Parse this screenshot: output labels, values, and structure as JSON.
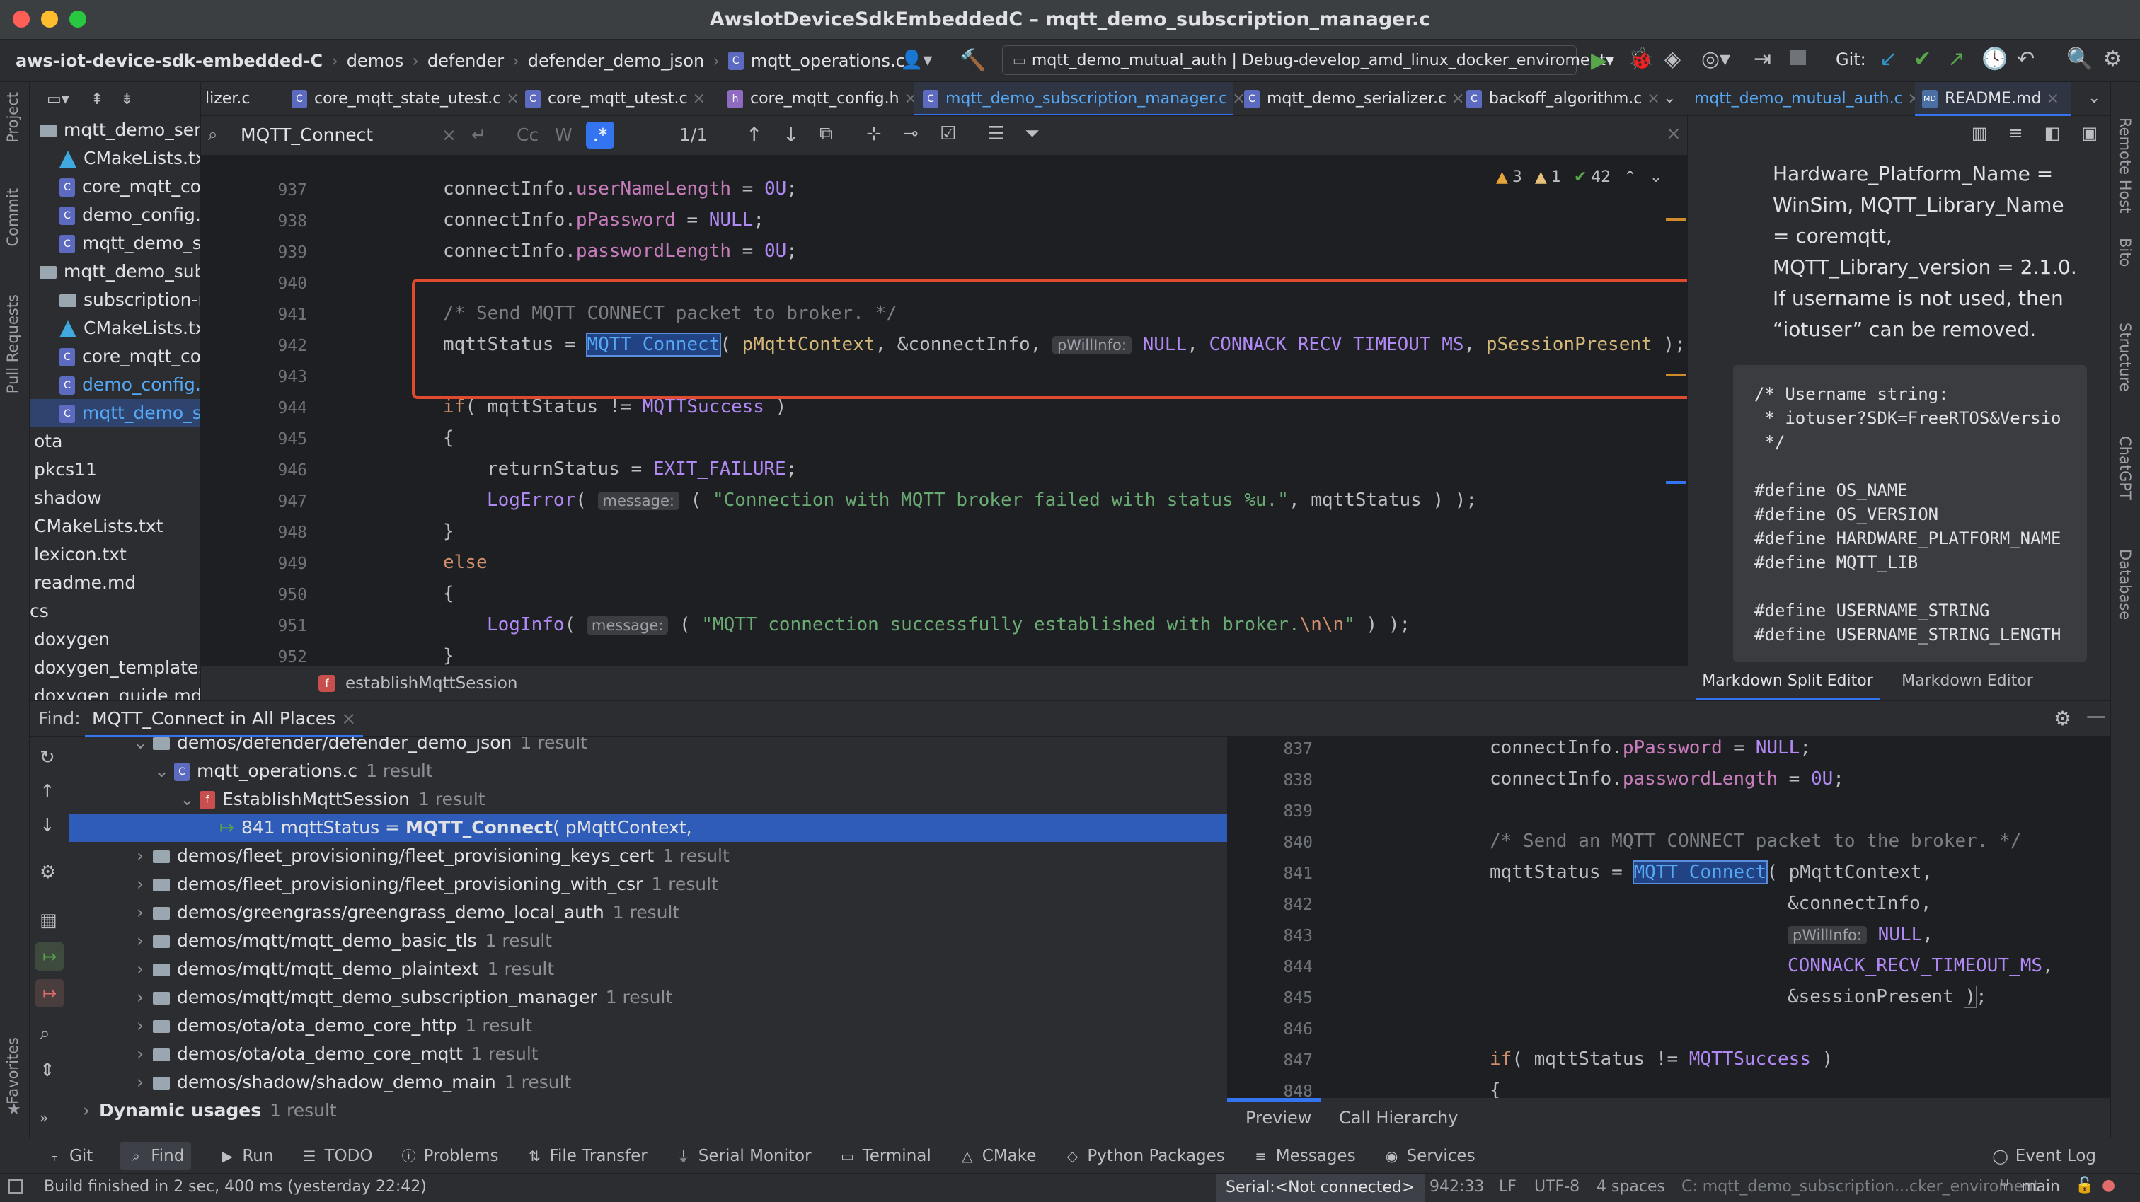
{
  "window": {
    "title": "AwsIotDeviceSdkEmbeddedC – mqtt_demo_subscription_manager.c"
  },
  "navbar": {
    "crumbs": [
      "aws-iot-device-sdk-embedded-C",
      "demos",
      "defender",
      "defender_demo_json",
      "mqtt_operations.c"
    ],
    "run_config": "mqtt_demo_mutual_auth | Debug-develop_amd_linux_docker_enviroment",
    "git_label": "Git:"
  },
  "left_strip": [
    "Project",
    "Commit",
    "Pull Requests",
    "Favorites"
  ],
  "right_strip": [
    "Remote Host",
    "Bito",
    "Structure",
    "ChatGPT",
    "Database"
  ],
  "project_tree": [
    {
      "name": "mqtt_demo_seria",
      "kind": "folder",
      "indent": 0
    },
    {
      "name": "CMakeLists.tx",
      "kind": "cmake",
      "indent": 1
    },
    {
      "name": "core_mqtt_co",
      "kind": "c",
      "indent": 1
    },
    {
      "name": "demo_config.l",
      "kind": "c",
      "indent": 1
    },
    {
      "name": "mqtt_demo_s",
      "kind": "c",
      "indent": 1
    },
    {
      "name": "mqtt_demo_subs",
      "kind": "folder",
      "indent": 0
    },
    {
      "name": "subscription-r",
      "kind": "folder",
      "indent": 1
    },
    {
      "name": "CMakeLists.tx",
      "kind": "cmake",
      "indent": 1
    },
    {
      "name": "core_mqtt_co",
      "kind": "c",
      "indent": 1
    },
    {
      "name": "demo_config.l",
      "kind": "c",
      "indent": 1
    },
    {
      "name": "mqtt_demo_s",
      "kind": "c",
      "indent": 1
    },
    {
      "name": "ota",
      "kind": "plain",
      "indent": 0
    },
    {
      "name": "pkcs11",
      "kind": "plain",
      "indent": 0
    },
    {
      "name": "shadow",
      "kind": "plain",
      "indent": 0
    },
    {
      "name": "CMakeLists.txt",
      "kind": "plain",
      "indent": 0
    },
    {
      "name": "lexicon.txt",
      "kind": "plain",
      "indent": 0
    },
    {
      "name": "readme.md",
      "kind": "plain",
      "indent": 0
    },
    {
      "name": "cs",
      "kind": "plain",
      "indent": -1
    },
    {
      "name": "doxygen",
      "kind": "plain",
      "indent": 0
    },
    {
      "name": "doxygen_templates",
      "kind": "plain",
      "indent": 0
    },
    {
      "name": "doxygen_guide.md",
      "kind": "plain",
      "indent": 0
    }
  ],
  "tabs": [
    {
      "label": "lizer.c"
    },
    {
      "label": "core_mqtt_state_utest.c"
    },
    {
      "label": "core_mqtt_utest.c"
    },
    {
      "label": "core_mqtt_config.h"
    },
    {
      "label": "mqtt_demo_subscription_manager.c"
    },
    {
      "label": "mqtt_demo_serializer.c"
    },
    {
      "label": "backoff_algorithm.c"
    }
  ],
  "right_tabs": [
    {
      "label": "mqtt_demo_mutual_auth.c"
    },
    {
      "label": "README.md"
    }
  ],
  "find": {
    "query": "MQTT_Connect",
    "count": "1/1",
    "cc": "Cc",
    "w": "W",
    "regex": ".*"
  },
  "inspections": {
    "warn": "3",
    "weak": "1",
    "ok": "42"
  },
  "editor_lines": [
    "937",
    "938",
    "939",
    "940",
    "941",
    "942",
    "943",
    "944",
    "945",
    "946",
    "947",
    "948",
    "949",
    "950",
    "951",
    "952"
  ],
  "code": {
    "l937a": "connectInfo.",
    "l937b": "userNameLength",
    "l937c": " = ",
    "l937d": "0U",
    "l937e": ";",
    "l938a": "connectInfo.",
    "l938b": "pPassword",
    "l938c": " = ",
    "l938d": "NULL",
    "l938e": ";",
    "l939a": "connectInfo.",
    "l939b": "passwordLength",
    "l939c": " = ",
    "l939d": "0U",
    "l939e": ";",
    "l941": "/* Send MQTT CONNECT packet to broker. */",
    "l942a": "mqttStatus = ",
    "l942b": "MQTT_Connect",
    "l942c": "( ",
    "l942d": "pMqttContext",
    "l942e": ", &connectInfo, ",
    "l942hint": "pWillInfo:",
    "l942f": "NULL",
    "l942g": ", ",
    "l942h": "CONNACK_RECV_TIMEOUT_MS",
    "l942i": ", ",
    "l942j": "pSessionPresent",
    "l942k": " );",
    "l944a": "if",
    "l944b": "( mqttStatus != ",
    "l944c": "MQTTSuccess",
    "l944d": " )",
    "l945": "{",
    "l946a": "returnStatus = ",
    "l946b": "EXIT_FAILURE",
    "l946c": ";",
    "l947a": "LogError",
    "l947b": "( ",
    "l947hint": "message:",
    "l947c": " ( ",
    "l947d": "\"Connection with MQTT broker failed with status %u.\"",
    "l947e": ", mqttStatus ) );",
    "l948": "}",
    "l949": "else",
    "l950": "{",
    "l951a": "LogInfo",
    "l951b": "( ",
    "l951hint": "message:",
    "l951c": " ( ",
    "l951d": "\"MQTT connection successfully established with broker.",
    "l951e": "\\n\\n",
    "l951f": "\"",
    "l951g": " ) );",
    "l952": "}"
  },
  "breadcrumb_fn": "establishMqttSession",
  "preview": {
    "para": [
      "Hardware_Platform_Name =",
      "WinSim, MQTT_Library_Name",
      "= coremqtt,",
      "MQTT_Library_version = 2.1.0.",
      "If username is not used, then",
      "“iotuser” can be removed."
    ],
    "codeblock": [
      "/* Username string:",
      " * iotuser?SDK=FreeRTOS&Versio",
      " */",
      "",
      "#define OS_NAME",
      "#define OS_VERSION",
      "#define HARDWARE_PLATFORM_NAME",
      "#define MQTT_LIB",
      "",
      "#define USERNAME_STRING",
      "#define USERNAME_STRING_LENGTH"
    ]
  },
  "preview_tabs": [
    "Markdown Split Editor",
    "Markdown Editor"
  ],
  "find_panel": {
    "label": "Find:",
    "tab": "MQTT_Connect in All Places"
  },
  "results": [
    {
      "text": "demos/defender/defender_demo_json",
      "count": "1 result",
      "indent": 1,
      "kind": "folder",
      "arrow": "v"
    },
    {
      "text": "mqtt_operations.c",
      "count": "1 result",
      "indent": 2,
      "kind": "c",
      "arrow": "v"
    },
    {
      "text": "EstablishMqttSession",
      "count": "1 result",
      "indent": 3,
      "kind": "fn",
      "arrow": "v"
    },
    {
      "text": "841 mqttStatus = ",
      "bold": "MQTT_Connect",
      "rest": "( pMqttContext,",
      "count": "",
      "indent": 4,
      "kind": "usage",
      "arrow": "",
      "selected": true
    },
    {
      "text": "demos/fleet_provisioning/fleet_provisioning_keys_cert",
      "count": "1 result",
      "indent": 1,
      "kind": "folder",
      "arrow": ">"
    },
    {
      "text": "demos/fleet_provisioning/fleet_provisioning_with_csr",
      "count": "1 result",
      "indent": 1,
      "kind": "folder",
      "arrow": ">"
    },
    {
      "text": "demos/greengrass/greengrass_demo_local_auth",
      "count": "1 result",
      "indent": 1,
      "kind": "folder",
      "arrow": ">"
    },
    {
      "text": "demos/mqtt/mqtt_demo_basic_tls",
      "count": "1 result",
      "indent": 1,
      "kind": "folder",
      "arrow": ">"
    },
    {
      "text": "demos/mqtt/mqtt_demo_plaintext",
      "count": "1 result",
      "indent": 1,
      "kind": "folder",
      "arrow": ">"
    },
    {
      "text": "demos/mqtt/mqtt_demo_subscription_manager",
      "count": "1 result",
      "indent": 1,
      "kind": "folder",
      "arrow": ">"
    },
    {
      "text": "demos/ota/ota_demo_core_http",
      "count": "1 result",
      "indent": 1,
      "kind": "folder",
      "arrow": ">"
    },
    {
      "text": "demos/ota/ota_demo_core_mqtt",
      "count": "1 result",
      "indent": 1,
      "kind": "folder",
      "arrow": ">"
    },
    {
      "text": "demos/shadow/shadow_demo_main",
      "count": "1 result",
      "indent": 1,
      "kind": "folder",
      "arrow": ">"
    },
    {
      "text": "Dynamic usages",
      "count": "1 result",
      "indent": 0,
      "kind": "bold",
      "arrow": ">"
    }
  ],
  "result_preview_lines": [
    "837",
    "838",
    "839",
    "840",
    "841",
    "842",
    "843",
    "844",
    "845",
    "846",
    "847",
    "848"
  ],
  "rp": {
    "l837a": "connectInfo.",
    "l837b": "pPassword",
    "l837c": " = ",
    "l837d": "NULL",
    "l837e": ";",
    "l838a": "connectInfo.",
    "l838b": "passwordLength",
    "l838c": " = ",
    "l838d": "0U",
    "l838e": ";",
    "l840": "/* Send an MQTT CONNECT packet to the broker. */",
    "l841a": "mqttStatus = ",
    "l841b": "MQTT_Connect",
    "l841c": "( pMqttContext,",
    "l842": "&connectInfo,",
    "l843hint": "pWillInfo:",
    "l843a": "NULL",
    "l843b": ",",
    "l844a": "CONNACK_RECV_TIMEOUT_MS",
    "l844b": ",",
    "l845a": "&sessionPresent ",
    "l845b": ")",
    "l845c": ";",
    "l847a": "if",
    "l847b": "( mqttStatus != ",
    "l847c": "MQTTSuccess",
    "l847d": " )",
    "l848": "{"
  },
  "rprev_tabs": [
    "Preview",
    "Call Hierarchy"
  ],
  "toolwindows": [
    "Git",
    "Find",
    "Run",
    "TODO",
    "Problems",
    "File Transfer",
    "Serial Monitor",
    "Terminal",
    "CMake",
    "Python Packages",
    "Messages",
    "Services",
    "Event Log"
  ],
  "status": {
    "message": "Build finished in 2 sec, 400 ms (yesterday 22:42)",
    "serial": "Serial:<Not connected>",
    "pos": "942:33",
    "lf": "LF",
    "enc": "UTF-8",
    "indent": "4 spaces",
    "ctx": "C: mqtt_demo_subscription...cker_enviroment",
    "branch": "main"
  },
  "colors": {
    "accent": "#3574f0",
    "highlight": "#e04b2f",
    "run_green": "#57a64a"
  }
}
